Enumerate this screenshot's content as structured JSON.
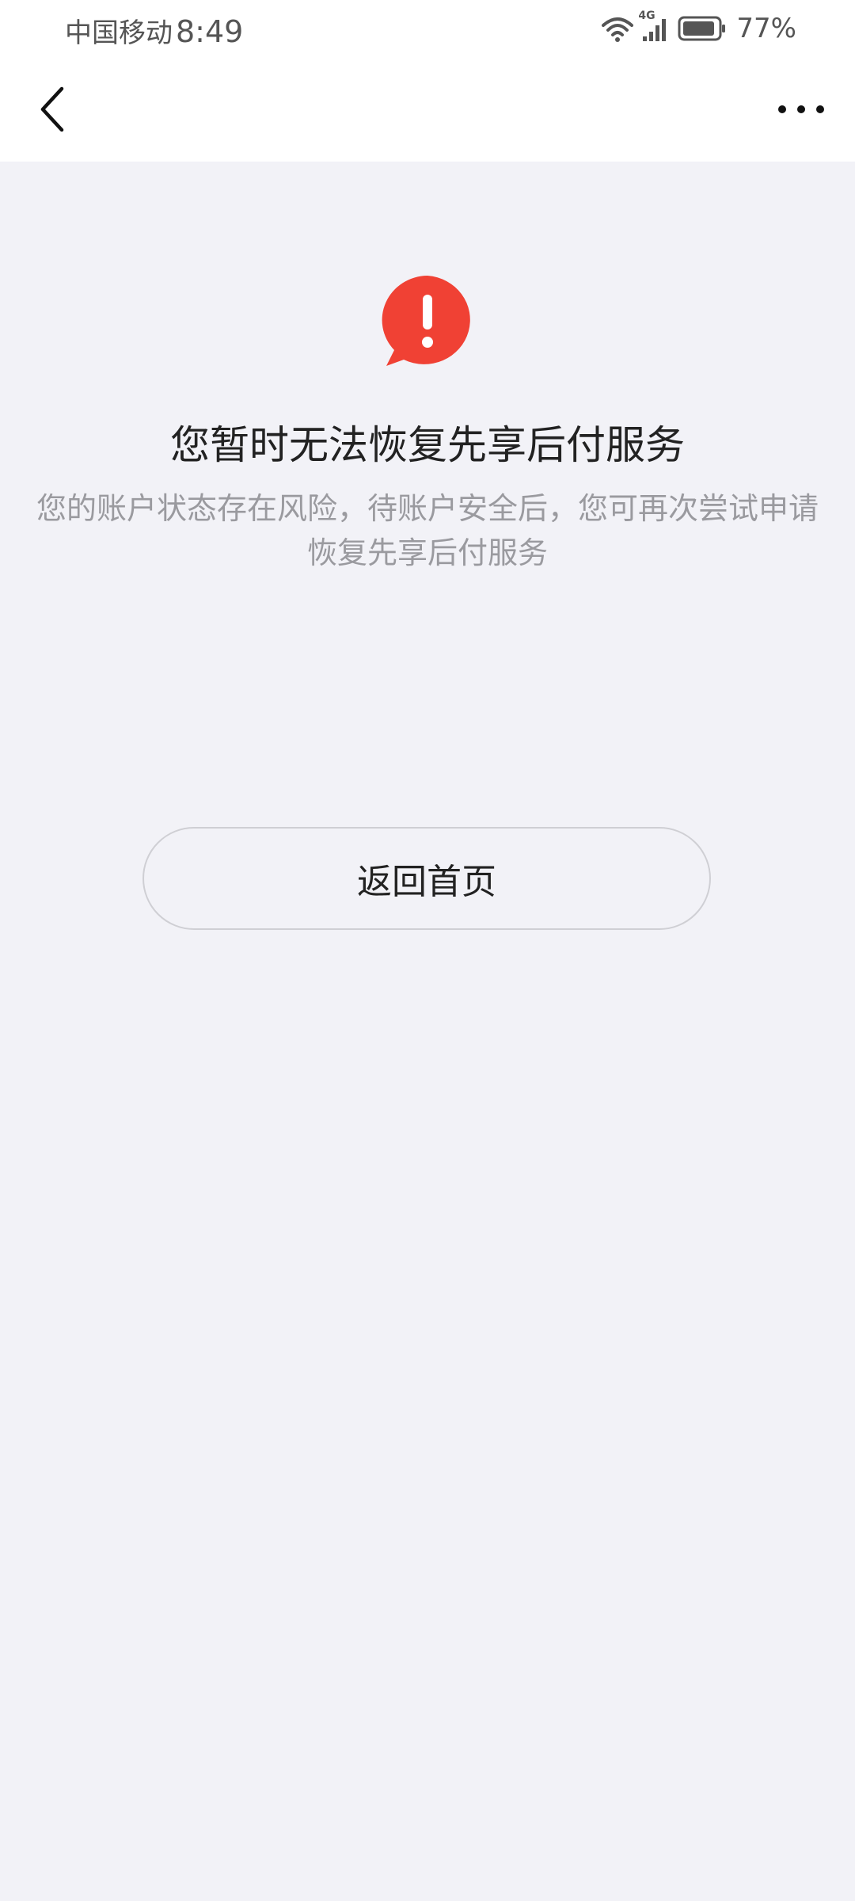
{
  "status_bar": {
    "carrier": "中国移动",
    "time": "8:49",
    "network_type": "4G",
    "battery_percent": "77%",
    "battery_level": 0.77,
    "icons": [
      "wifi-icon",
      "signal-icon",
      "battery-icon"
    ]
  },
  "nav": {
    "back_icon": "chevron-left-icon",
    "more_icon": "more-dots-icon"
  },
  "alert": {
    "icon": "exclamation-bubble-icon",
    "color": "#f04134"
  },
  "main": {
    "title": "您暂时无法恢复先享后付服务",
    "subtitle": "您的账户状态存在风险，待账户安全后，您可再次尝试申请恢复先享后付服务",
    "home_button_label": "返回首页"
  }
}
